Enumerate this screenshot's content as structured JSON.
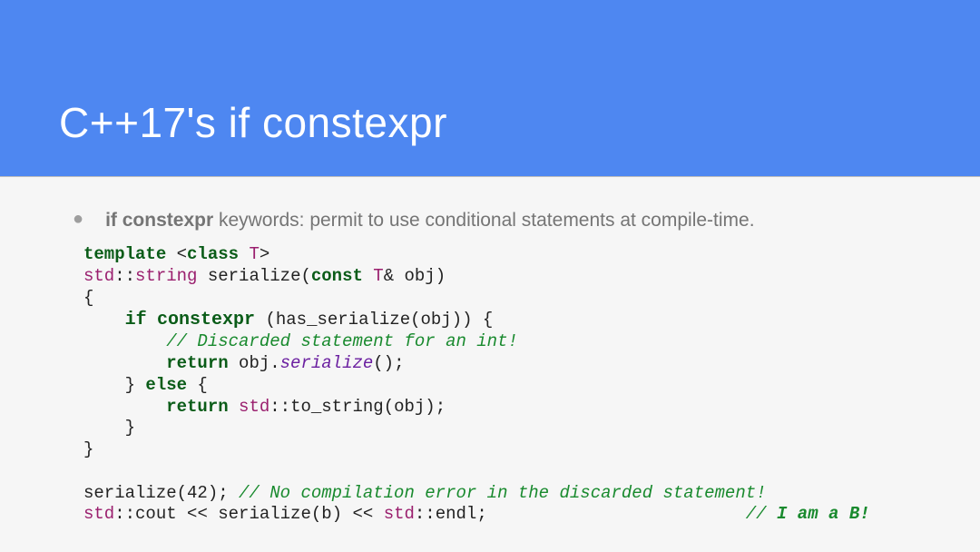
{
  "header": {
    "title": "C++17's if constexpr"
  },
  "bullet": {
    "lead": "if constexpr",
    "rest": " keywords: permit to use conditional statements at compile-time."
  },
  "code": {
    "l1_kw1": "template",
    "l1_op1": " <",
    "l1_kw2": "class",
    "l1_sp": " ",
    "l1_tp": "T",
    "l1_op2": ">",
    "l2_ns": "std",
    "l2_cc": "::",
    "l2_ty": "string",
    "l2_sp": " serialize(",
    "l2_kw": "const",
    "l2_sp2": " ",
    "l2_tp": "T",
    "l2_op": "& obj)",
    "l3": "{",
    "l4_in": "    ",
    "l4_kw1": "if",
    "l4_sp": " ",
    "l4_kw2": "constexpr",
    "l4_rest": " (has_serialize(obj)) {",
    "l5_in": "        ",
    "l5_c": "// Discarded statement for an int!",
    "l6_in": "        ",
    "l6_kw": "return",
    "l6_t1": " obj.",
    "l6_m": "serialize",
    "l6_t2": "();",
    "l7_in": "    } ",
    "l7_kw": "else",
    "l7_t": " {",
    "l8_in": "        ",
    "l8_kw": "return",
    "l8_t1": " ",
    "l8_ns": "std",
    "l8_cc": "::",
    "l8_fn": "to_string",
    "l8_t2": "(obj);",
    "l9": "    }",
    "l10": "}",
    "blank": "",
    "l11_t": "serialize(42); ",
    "l11_c": "// No compilation error in the discarded statement!",
    "l12_ns": "std",
    "l12_cc": "::",
    "l12_t1": "cout << serialize(b) << ",
    "l12_ns2": "std",
    "l12_cc2": "::",
    "l12_t2": "endl;",
    "l12_pad": "                         ",
    "l12_c1": "// ",
    "l12_c2": "I am a B!"
  }
}
